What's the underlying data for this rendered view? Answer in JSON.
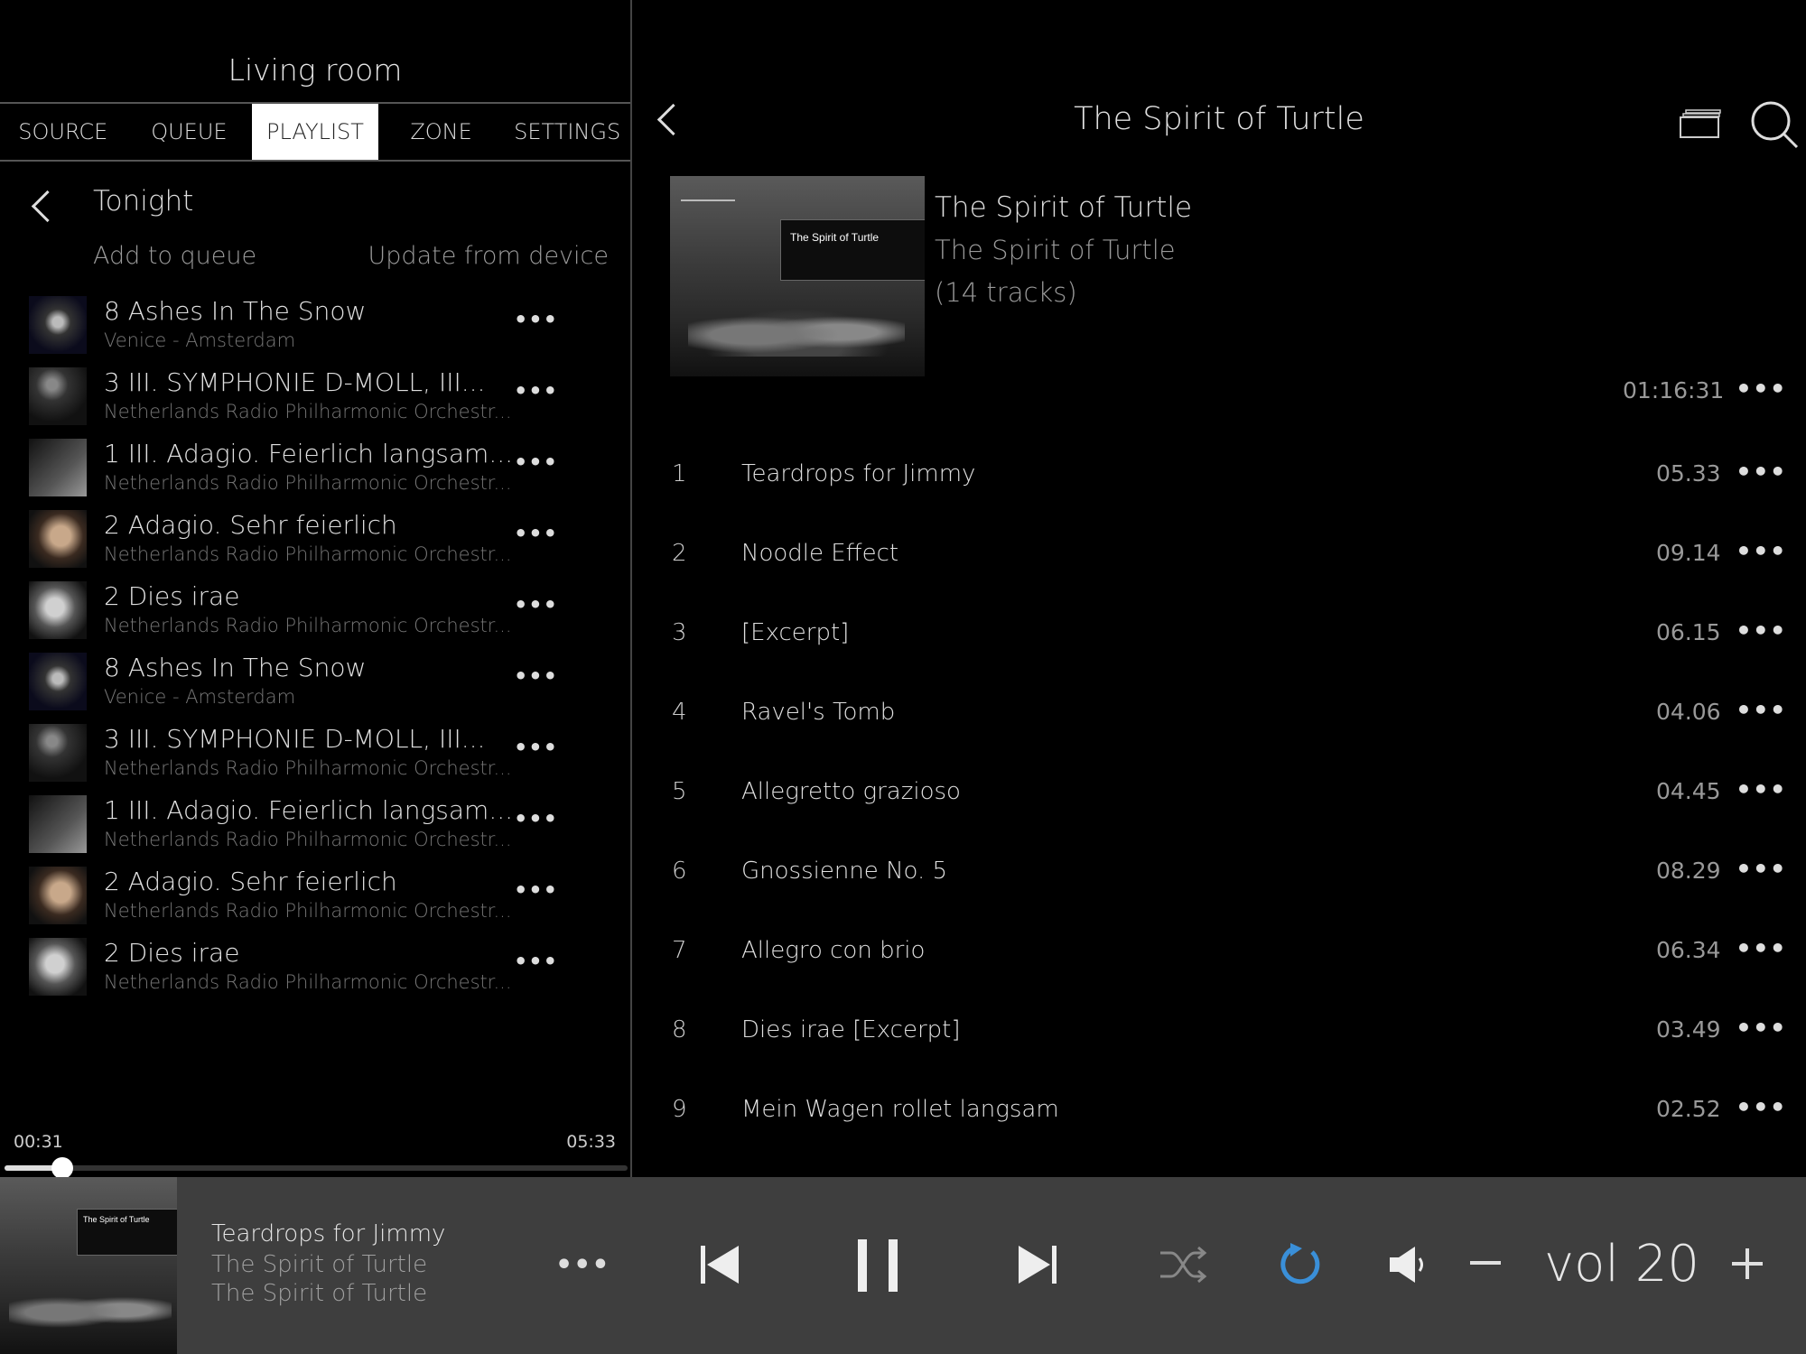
{
  "zone": {
    "title": "Living room"
  },
  "tabs": [
    {
      "label": "SOURCE",
      "active": false
    },
    {
      "label": "QUEUE",
      "active": false
    },
    {
      "label": "PLAYLIST",
      "active": true
    },
    {
      "label": "ZONE",
      "active": false
    },
    {
      "label": "SETTINGS",
      "active": false
    }
  ],
  "playlist": {
    "name": "Tonight",
    "add_to_queue": "Add to queue",
    "update_from_device": "Update from device",
    "items": [
      {
        "title": "8 Ashes In The Snow",
        "subtitle": "Venice - Amsterdam"
      },
      {
        "title": "3 III. SYMPHONIE D-MOLL, III...",
        "subtitle": "Netherlands Radio Philharmonic Orchestr..."
      },
      {
        "title": "1 III. Adagio. Feierlich langsam...",
        "subtitle": "Netherlands Radio Philharmonic Orchestr..."
      },
      {
        "title": "2 Adagio. Sehr feierlich",
        "subtitle": "Netherlands Radio Philharmonic Orchestr..."
      },
      {
        "title": "2 Dies irae",
        "subtitle": "Netherlands Radio Philharmonic Orchestr..."
      },
      {
        "title": "8 Ashes In The Snow",
        "subtitle": "Venice - Amsterdam"
      },
      {
        "title": "3 III. SYMPHONIE D-MOLL, III...",
        "subtitle": "Netherlands Radio Philharmonic Orchestr..."
      },
      {
        "title": "1 III. Adagio. Feierlich langsam...",
        "subtitle": "Netherlands Radio Philharmonic Orchestr..."
      },
      {
        "title": "2 Adagio. Sehr feierlich",
        "subtitle": "Netherlands Radio Philharmonic Orchestr..."
      },
      {
        "title": "2 Dies irae",
        "subtitle": "Netherlands Radio Philharmonic Orchestr..."
      }
    ]
  },
  "progress": {
    "elapsed": "00:31",
    "total": "05:33",
    "fraction": 0.093
  },
  "album": {
    "header_title": "The Spirit of Turtle",
    "name": "The Spirit of Turtle",
    "artist": "The Spirit of Turtle",
    "track_count": "(14 tracks)",
    "duration": "01:16:31",
    "cover_text": "The Spirit of Turtle",
    "tracks": [
      {
        "num": "1",
        "title": "Teardrops for Jimmy",
        "duration": "05.33"
      },
      {
        "num": "2",
        "title": "Noodle Effect",
        "duration": "09.14"
      },
      {
        "num": "3",
        "title": "[Excerpt]",
        "duration": "06.15"
      },
      {
        "num": "4",
        "title": "Ravel's Tomb",
        "duration": "04.06"
      },
      {
        "num": "5",
        "title": "Allegretto grazioso",
        "duration": "04.45"
      },
      {
        "num": "6",
        "title": "Gnossienne No. 5",
        "duration": "08.29"
      },
      {
        "num": "7",
        "title": "Allegro con brio",
        "duration": "06.34"
      },
      {
        "num": "8",
        "title": "Dies irae [Excerpt]",
        "duration": "03.49"
      },
      {
        "num": "9",
        "title": "Mein Wagen rollet langsam",
        "duration": "02.52"
      }
    ]
  },
  "now_playing": {
    "track": "Teardrops for Jimmy",
    "album": "The Spirit of Turtle",
    "artist": "The Spirit of Turtle",
    "cover_text": "The Spirit of Turtle",
    "volume_label": "vol 20"
  },
  "icons": {
    "more": "more-icon",
    "back": "chevron-left-icon",
    "albums": "albums-icon",
    "search": "search-icon",
    "previous": "skip-previous-icon",
    "pause": "pause-icon",
    "next": "skip-next-icon",
    "shuffle": "shuffle-icon",
    "repeat": "repeat-icon",
    "speaker": "speaker-icon"
  },
  "colors": {
    "repeat_active": "#3a8fd8",
    "background": "#000000",
    "bar": "#3e3e3e"
  }
}
